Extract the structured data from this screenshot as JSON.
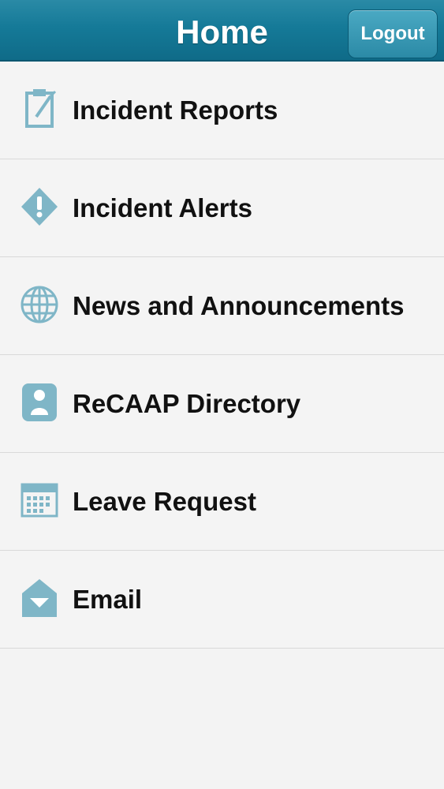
{
  "header": {
    "title": "Home",
    "logout_label": "Logout"
  },
  "menu": {
    "items": [
      {
        "label": "Incident Reports",
        "icon": "clipboard-icon"
      },
      {
        "label": "Incident Alerts",
        "icon": "alert-diamond-icon"
      },
      {
        "label": "News and Announcements",
        "icon": "globe-icon"
      },
      {
        "label": "ReCAAP Directory",
        "icon": "contact-card-icon"
      },
      {
        "label": "Leave Request",
        "icon": "calendar-icon"
      },
      {
        "label": "Email",
        "icon": "envelope-icon"
      }
    ]
  },
  "colors": {
    "header": "#157a98",
    "icon": "#7fb6c7",
    "background": "#f3f3f3",
    "divider": "#d9d9d9"
  }
}
